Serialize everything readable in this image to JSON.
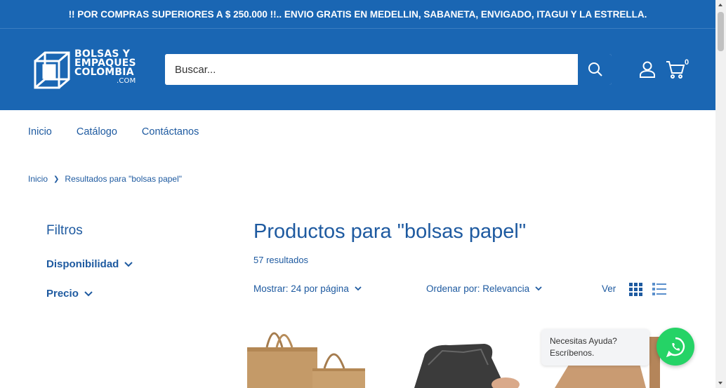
{
  "announcement": "!! POR COMPRAS SUPERIORES A $ 250.000 !!.. ENVIO GRATIS EN MEDELLIN, SABANETA, ENVIGADO, ITAGUI Y LA ESTRELLA.",
  "logo": {
    "line1": "BOLSAS Y",
    "line2": "EMPAQUES",
    "line3": "COLOMBIA",
    "line4": ".COM"
  },
  "search": {
    "placeholder": "Buscar..."
  },
  "cart": {
    "count": "0"
  },
  "nav": {
    "items": [
      "Inicio",
      "Catálogo",
      "Contáctanos"
    ]
  },
  "breadcrumb": {
    "home": "Inicio",
    "current": "Resultados para \"bolsas papel\""
  },
  "filters": {
    "title": "Filtros",
    "availability": "Disponibilidad",
    "price": "Precio"
  },
  "main": {
    "title": "Productos para \"bolsas papel\"",
    "results": "57 resultados",
    "show": "Mostrar: 24 por página",
    "sort": "Ordenar por: Relevancia",
    "view": "Ver"
  },
  "chat": {
    "line1": "Necesitas Ayuda?",
    "line2": "Escríbenos."
  },
  "colors": {
    "brand": "#1a66b3",
    "text": "#1e5aa0",
    "whatsapp": "#25d366"
  },
  "icons": [
    "logo-icon",
    "search-icon",
    "account-icon",
    "cart-icon",
    "chevron-down-icon",
    "grid-view-icon",
    "list-view-icon",
    "whatsapp-icon"
  ]
}
